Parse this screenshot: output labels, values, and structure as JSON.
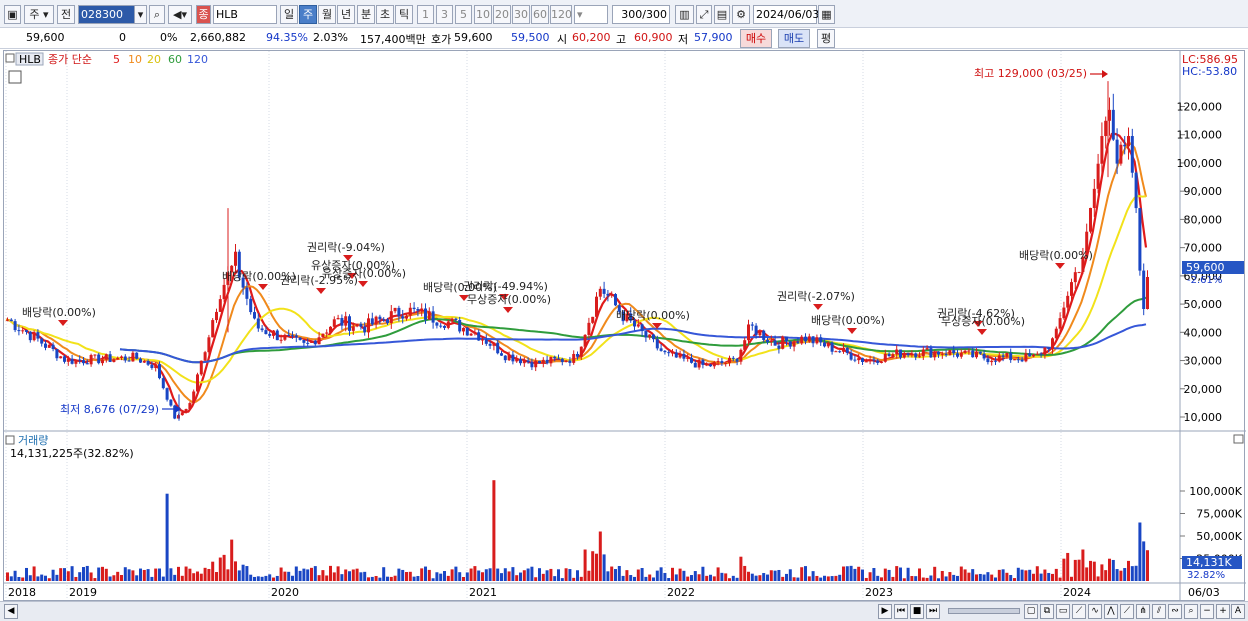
{
  "toolbar": {
    "type_selector": "주",
    "prev_label": "전",
    "code_value": "028300",
    "market_badge": "종",
    "name_value": "HLB",
    "periods": [
      "일",
      "주",
      "월",
      "년",
      "분",
      "초",
      "틱"
    ],
    "active_period": "주",
    "intervals": [
      "1",
      "3",
      "5",
      "10",
      "20",
      "30",
      "60",
      "120"
    ],
    "count_value": "300",
    "count_total": "/300",
    "date_value": "2024/06/03"
  },
  "quote": {
    "price": "59,600",
    "change": "0",
    "change_pct": "0%",
    "volume": "2,660,882",
    "vol_ratio": "94.35%",
    "turnover": "2.03%",
    "amount": "157,400백만",
    "bid_label": "호가",
    "bid1": "59,600",
    "bid2": "59,500",
    "open_label": "시",
    "open": "60,200",
    "high_label": "고",
    "high": "60,900",
    "low_label": "저",
    "low": "57,900",
    "buy_label": "매수",
    "sell_label": "매도",
    "eval_label": "평"
  },
  "price_panel": {
    "symbol": "HLB",
    "legend_prefix": "종가 단순",
    "ma_periods": [
      "5",
      "10",
      "20",
      "60",
      "120"
    ],
    "ma_colors": [
      "#e01b1b",
      "#f08a1c",
      "#f2e21a",
      "#2f9c3c",
      "#3657d8"
    ],
    "lc_label": "LC:586.95",
    "hc_label": "HC:-53.80",
    "high_annotation": "최고 129,000 (03/25)",
    "low_annotation": "최저 8,676 (07/29)",
    "current_price_tag": "59,600",
    "current_pct_tag": "-2.61%",
    "y_ticks": [
      "120,000",
      "110,000",
      "100,000",
      "90,000",
      "80,000",
      "70,000",
      "60,000",
      "50,000",
      "40,000",
      "30,000",
      "20,000",
      "10,000"
    ],
    "events": [
      "배당락(0.00%)",
      "배당락(0.00%)",
      "권리락(-2.95%)",
      "권리락(-9.04%)",
      "유상증자(0.00%)",
      "유상증자(0.00%)",
      "배당락(0.00%)",
      "권리락(-49.94%)",
      "무상증자(0.00%)",
      "배당락(0.00%)",
      "권리락(-2.07%)",
      "배당락(0.00%)",
      "권리락(-4.62%)",
      "무상증자(0.00%)",
      "배당락(0.00%)"
    ]
  },
  "volume_panel": {
    "title": "거래량",
    "current_volume": "14,131,225주(32.82%)",
    "y_ticks": [
      "100,000K",
      "75,000K",
      "50,000K",
      "25,000K"
    ],
    "current_tag": "14,131K",
    "current_pct_tag": "32.82%"
  },
  "x_axis": {
    "labels": [
      "2018",
      "2019",
      "2020",
      "2021",
      "2022",
      "2023",
      "2024"
    ],
    "end_label": "06/03"
  },
  "chart_data": {
    "type": "candlestick",
    "frequency": "weekly",
    "approx_closes": [
      {
        "date": "2018",
        "close": 45000
      },
      {
        "date": "2019-01",
        "close": 30000
      },
      {
        "date": "2019-06",
        "close": 30000
      },
      {
        "date": "2019-07-29",
        "close": 8676
      },
      {
        "date": "2019-09",
        "close": 80000
      },
      {
        "date": "2020-01",
        "close": 35000
      },
      {
        "date": "2020-06",
        "close": 50000
      },
      {
        "date": "2020-12",
        "close": 40000
      },
      {
        "date": "2021-03",
        "close": 30000
      },
      {
        "date": "2021-08",
        "close": 58000
      },
      {
        "date": "2022-01",
        "close": 30000
      },
      {
        "date": "2022-06",
        "close": 40000
      },
      {
        "date": "2023-01",
        "close": 32000
      },
      {
        "date": "2023-12",
        "close": 32000
      },
      {
        "date": "2024-01",
        "close": 55000
      },
      {
        "date": "2024-03-25",
        "close": 129000
      },
      {
        "date": "2024-05",
        "close": 48000
      },
      {
        "date": "2024-06-03",
        "close": 59600
      }
    ],
    "y_range": [
      5000,
      130000
    ]
  }
}
